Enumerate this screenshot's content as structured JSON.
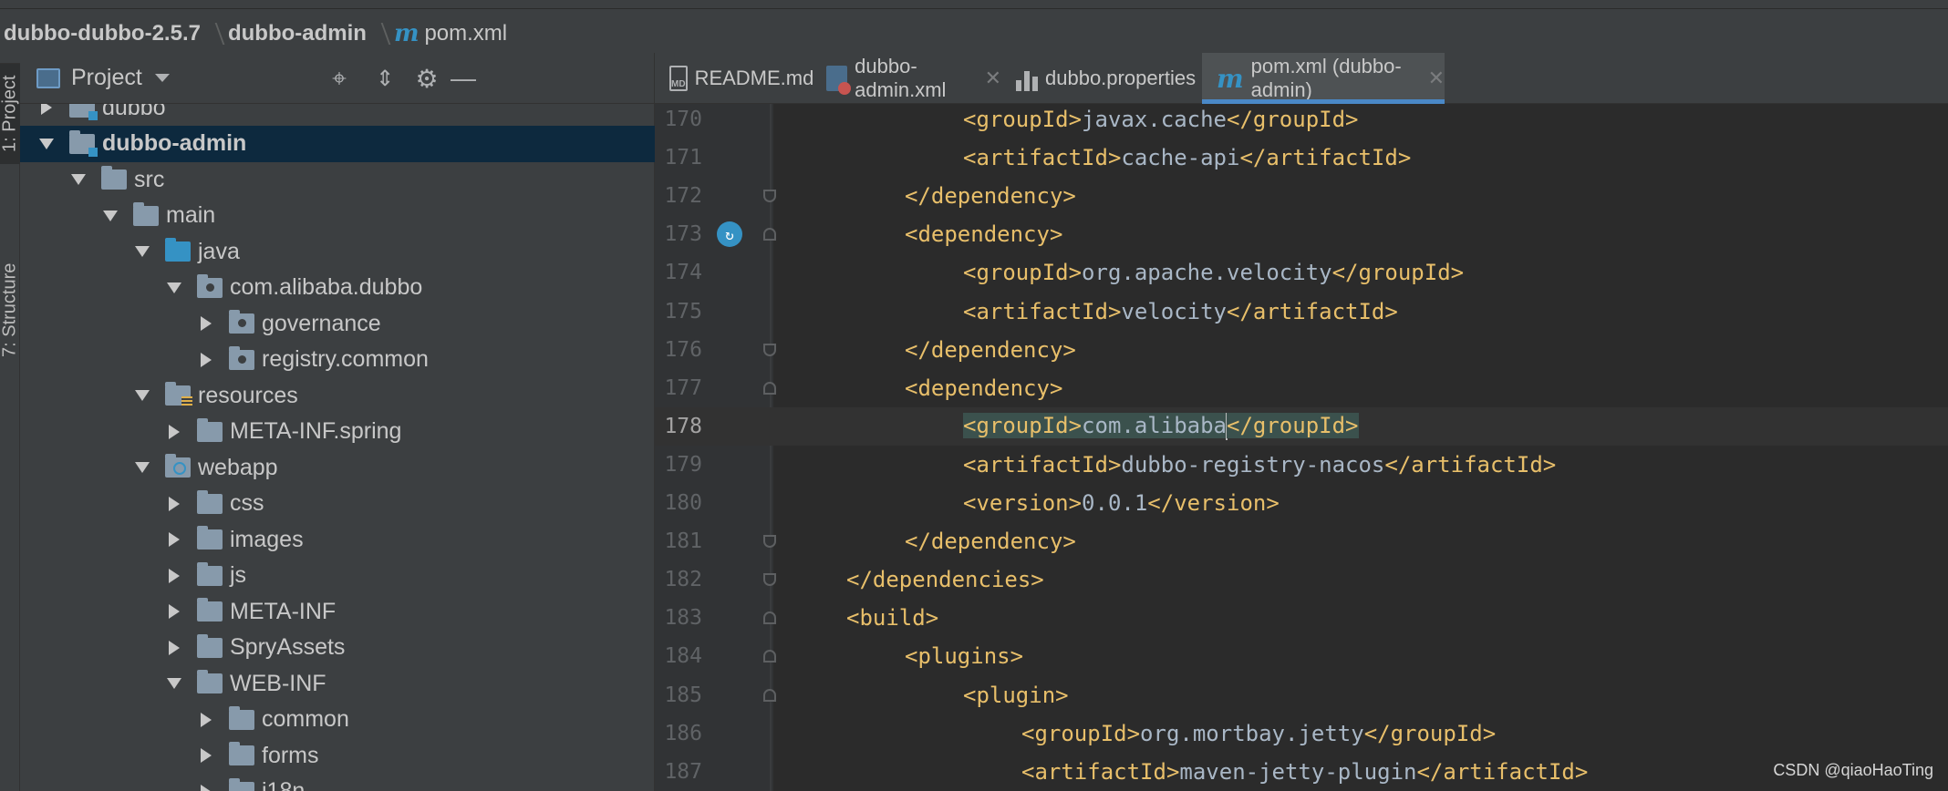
{
  "breadcrumb": {
    "root": "dubbo-dubbo-2.5.7",
    "module": "dubbo-admin",
    "file": "pom.xml"
  },
  "tool_strip": {
    "project": "1: Project",
    "structure": "7: Structure"
  },
  "project_panel": {
    "title": "Project"
  },
  "tree": [
    {
      "label": "dubbo",
      "arrow": "right",
      "kind": "mod"
    },
    {
      "label": "dubbo-admin",
      "arrow": "down",
      "kind": "mod",
      "selected": true
    },
    {
      "label": "src",
      "arrow": "down",
      "kind": "plain"
    },
    {
      "label": "main",
      "arrow": "down",
      "kind": "plain"
    },
    {
      "label": "java",
      "arrow": "down",
      "kind": "blue"
    },
    {
      "label": "com.alibaba.dubbo",
      "arrow": "down",
      "kind": "pkg"
    },
    {
      "label": "governance",
      "arrow": "right",
      "kind": "pkg"
    },
    {
      "label": "registry.common",
      "arrow": "right",
      "kind": "pkg"
    },
    {
      "label": "resources",
      "arrow": "down",
      "kind": "res"
    },
    {
      "label": "META-INF.spring",
      "arrow": "right",
      "kind": "plain"
    },
    {
      "label": "webapp",
      "arrow": "down",
      "kind": "web"
    },
    {
      "label": "css",
      "arrow": "right",
      "kind": "plain"
    },
    {
      "label": "images",
      "arrow": "right",
      "kind": "plain"
    },
    {
      "label": "js",
      "arrow": "right",
      "kind": "plain"
    },
    {
      "label": "META-INF",
      "arrow": "right",
      "kind": "plain"
    },
    {
      "label": "SpryAssets",
      "arrow": "right",
      "kind": "plain"
    },
    {
      "label": "WEB-INF",
      "arrow": "down",
      "kind": "plain"
    },
    {
      "label": "common",
      "arrow": "right",
      "kind": "plain"
    },
    {
      "label": "forms",
      "arrow": "right",
      "kind": "plain"
    },
    {
      "label": "i18n",
      "arrow": "right",
      "kind": "plain"
    }
  ],
  "tabs": [
    {
      "label": "README.md",
      "icon": "markdown-file-icon",
      "active": false
    },
    {
      "label": "dubbo-admin.xml",
      "icon": "xml-file-icon",
      "active": false
    },
    {
      "label": "dubbo.properties",
      "icon": "properties-file-icon",
      "active": false
    },
    {
      "label": "pom.xml (dubbo-admin)",
      "icon": "maven-file-icon",
      "active": true
    }
  ],
  "code_lines": [
    {
      "no": "170",
      "indent": 3,
      "open": "<groupId>",
      "text": "javax.cache",
      "close": "</groupId>"
    },
    {
      "no": "171",
      "indent": 3,
      "open": "<artifactId>",
      "text": "cache-api",
      "close": "</artifactId>"
    },
    {
      "no": "172",
      "indent": 2,
      "open": "",
      "text": "",
      "close": "</dependency>",
      "fold": "end"
    },
    {
      "no": "173",
      "indent": 2,
      "open": "<dependency>",
      "text": "",
      "close": "",
      "fold": "start",
      "icon": true
    },
    {
      "no": "174",
      "indent": 3,
      "open": "<groupId>",
      "text": "org.apache.velocity",
      "close": "</groupId>"
    },
    {
      "no": "175",
      "indent": 3,
      "open": "<artifactId>",
      "text": "velocity",
      "close": "</artifactId>"
    },
    {
      "no": "176",
      "indent": 2,
      "open": "",
      "text": "",
      "close": "</dependency>",
      "fold": "end"
    },
    {
      "no": "177",
      "indent": 2,
      "open": "<dependency>",
      "text": "",
      "close": "",
      "fold": "start"
    },
    {
      "no": "178",
      "indent": 3,
      "open": "<groupId>",
      "text": "com.alibaba",
      "close": "</groupId>",
      "current": true
    },
    {
      "no": "179",
      "indent": 3,
      "open": "<artifactId>",
      "text": "dubbo-registry-nacos",
      "close": "</artifactId>"
    },
    {
      "no": "180",
      "indent": 3,
      "open": "<version>",
      "text": "0.0.1",
      "close": "</version>"
    },
    {
      "no": "181",
      "indent": 2,
      "open": "",
      "text": "",
      "close": "</dependency>",
      "fold": "end"
    },
    {
      "no": "182",
      "indent": 1,
      "open": "",
      "text": "",
      "close": "</dependencies>",
      "fold": "end"
    },
    {
      "no": "183",
      "indent": 1,
      "open": "<build>",
      "text": "",
      "close": "",
      "fold": "start"
    },
    {
      "no": "184",
      "indent": 2,
      "open": "<plugins>",
      "text": "",
      "close": "",
      "fold": "start"
    },
    {
      "no": "185",
      "indent": 3,
      "open": "<plugin>",
      "text": "",
      "close": "",
      "fold": "start"
    },
    {
      "no": "186",
      "indent": 4,
      "open": "<groupId>",
      "text": "org.mortbay.jetty",
      "close": "</groupId>"
    },
    {
      "no": "187",
      "indent": 4,
      "open": "<artifactId>",
      "text": "maven-jetty-plugin",
      "close": "</artifactId>"
    }
  ],
  "watermark": "CSDN @qiaoHaoTing",
  "colors": {
    "tag": "#e8bf6a",
    "text": "#a9b7c6",
    "selection": "#0d293e",
    "accent": "#4a88c7"
  }
}
